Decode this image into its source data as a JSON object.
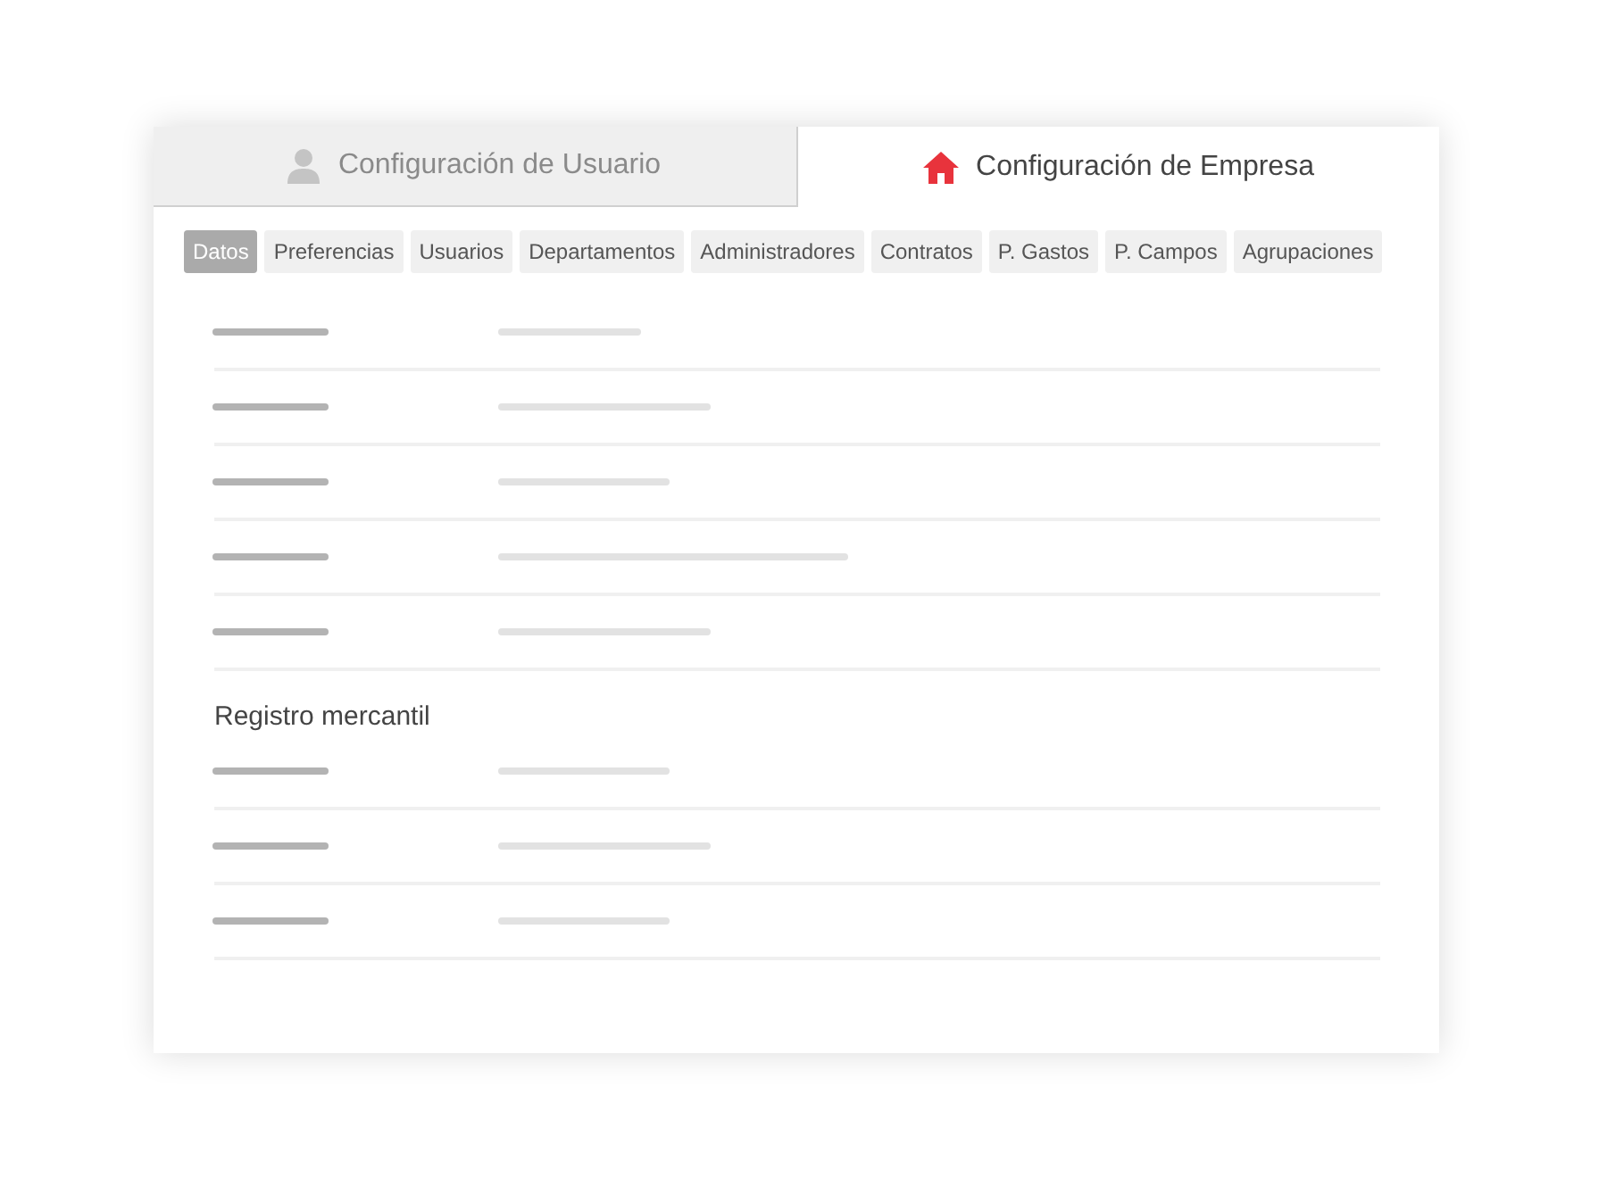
{
  "main_tabs": [
    {
      "label": "Configuración de Usuario",
      "selected": false
    },
    {
      "label": "Configuración de Empresa",
      "selected": true
    }
  ],
  "sub_tabs": [
    {
      "label": "Datos",
      "selected": true
    },
    {
      "label": "Preferencias",
      "selected": false
    },
    {
      "label": "Usuarios",
      "selected": false
    },
    {
      "label": "Departamentos",
      "selected": false
    },
    {
      "label": "Administradores",
      "selected": false
    },
    {
      "label": "Contratos",
      "selected": false
    },
    {
      "label": "P. Gastos",
      "selected": false
    },
    {
      "label": "P. Campos",
      "selected": false
    },
    {
      "label": "Agrupaciones",
      "selected": false
    }
  ],
  "section_heading": "Registro mercantil"
}
